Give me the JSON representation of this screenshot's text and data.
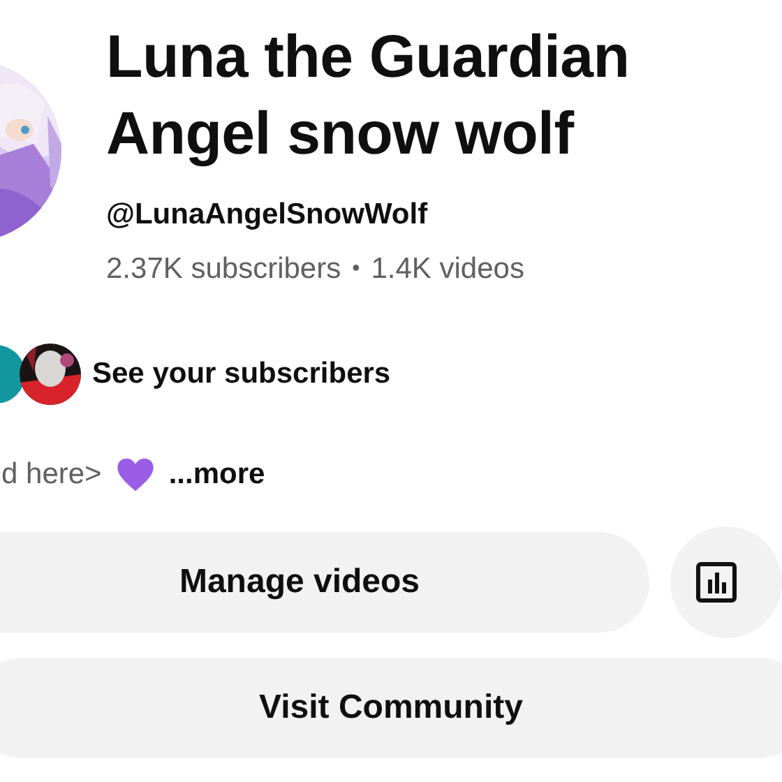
{
  "channel": {
    "name": "Luna the Guardian Angel snow wolf",
    "handle": "@LunaAngelSnowWolf",
    "subscribers": "2.37K subscribers",
    "separator": "•",
    "videos": "1.4K videos"
  },
  "subscribers_row": {
    "label": "See your subscribers"
  },
  "description": {
    "text": "d here>",
    "more": "...more"
  },
  "buttons": [
    {
      "kind": "pill",
      "label": "Manage videos"
    },
    {
      "kind": "icon"
    },
    {
      "kind": "wide",
      "label": "Visit Community"
    }
  ]
}
